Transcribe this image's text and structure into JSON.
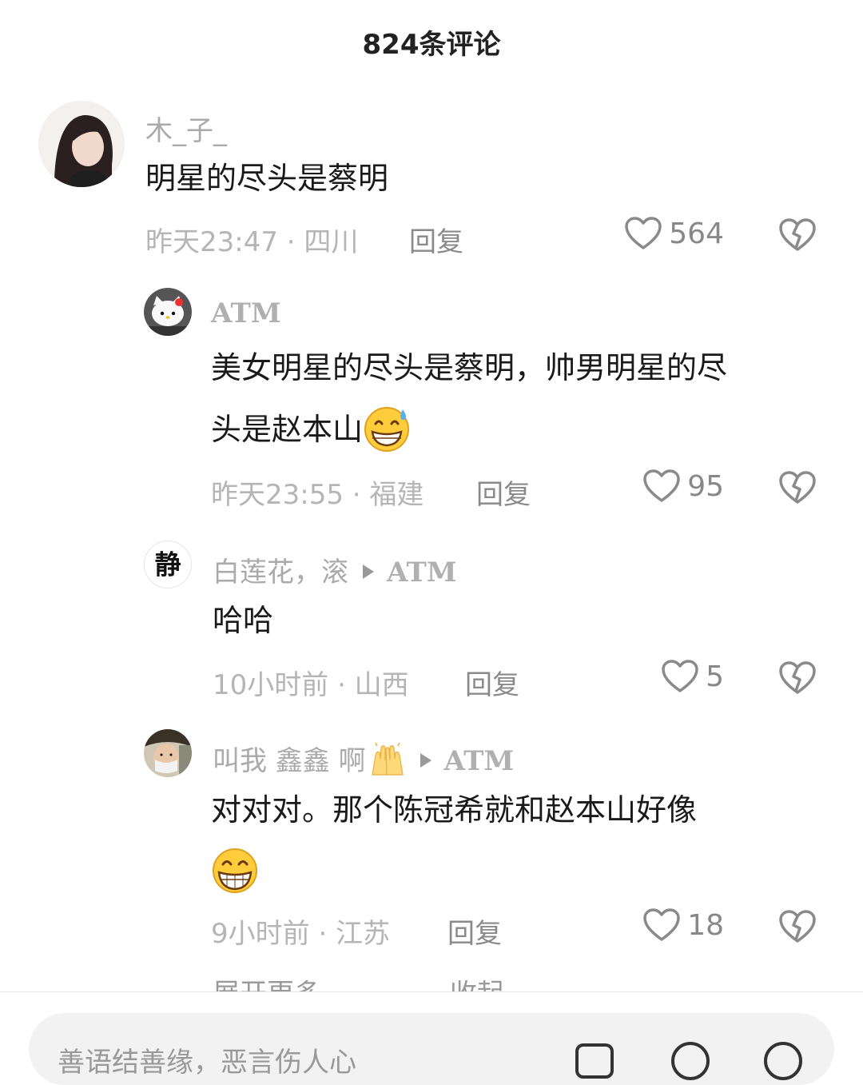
{
  "header": {
    "title": "824条评论"
  },
  "comments": [
    {
      "username": "木_子_",
      "content": "明星的尽头是蔡明",
      "time_location": "昨天23:47 · 四川",
      "reply_label": "回复",
      "likes": "564"
    },
    {
      "username": "ATM",
      "content_line1": "美女明星的尽头是蔡明，帅男明星的尽",
      "content_line2": "头是赵本山",
      "emoji": "grin-sweat-emoji",
      "time_location": "昨天23:55 · 福建",
      "reply_label": "回复",
      "likes": "95"
    },
    {
      "username": "白莲花，滚",
      "reply_to": "ATM",
      "content": "哈哈",
      "time_location": "10小时前 · 山西",
      "reply_label": "回复",
      "likes": "5"
    },
    {
      "username": "叫我 鑫鑫 啊",
      "username_emoji": "raised-hands-emoji",
      "reply_to": "ATM",
      "content": "对对对。那个陈冠希就和赵本山好像",
      "emoji": "grin-emoji",
      "time_location": "9小时前 · 江苏",
      "reply_label": "回复",
      "likes": "18"
    }
  ],
  "more_replies": {
    "expand_label": "展开更多",
    "collapse_label": "收起"
  },
  "input": {
    "placeholder": "善语结善缘，恶言伤人心"
  },
  "colors": {
    "muted_text": "#b5b5b5",
    "reply_text": "#8a8a8a",
    "content_text": "#1a1a1a",
    "emoji_yellow": "#ffcd3c"
  }
}
